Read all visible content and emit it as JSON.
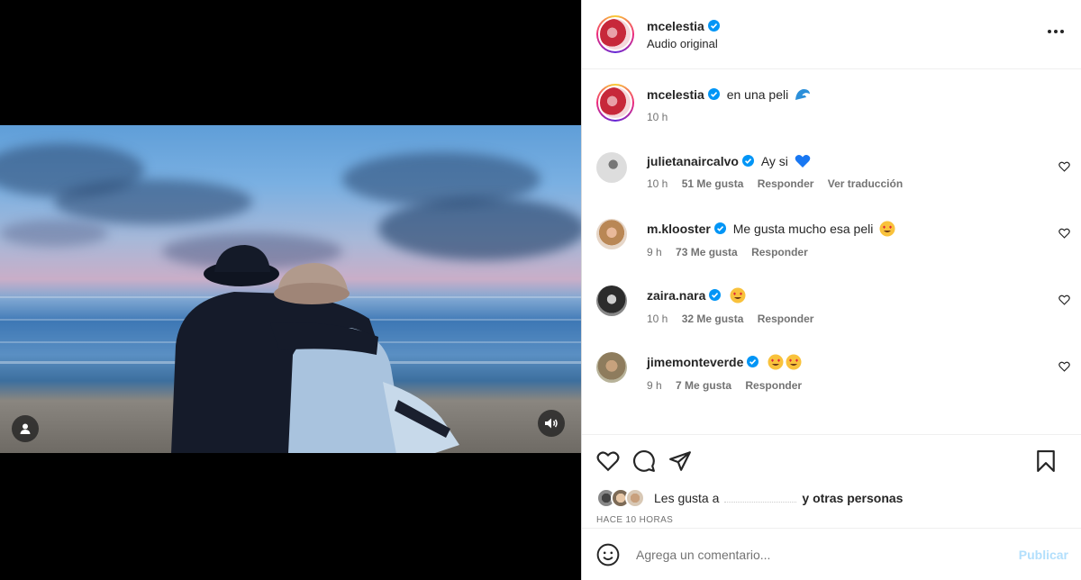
{
  "header": {
    "username": "mcelestia",
    "subtitle": "Audio original",
    "more_icon": "more-horizontal-icon"
  },
  "caption": {
    "username": "mcelestia",
    "text": "en una peli",
    "time": "10 h",
    "emoji": "wave-emoji"
  },
  "comments": [
    {
      "username": "julietanaircalvo",
      "text": "Ay si",
      "emoji": "blue-heart-emoji",
      "time": "10 h",
      "likes": "51 Me gusta",
      "reply": "Responder",
      "translate": "Ver traducción"
    },
    {
      "username": "m.klooster",
      "text": "Me gusta mucho esa peli",
      "emoji": "heart-eyes-emoji",
      "time": "9 h",
      "likes": "73 Me gusta",
      "reply": "Responder"
    },
    {
      "username": "zaira.nara",
      "text": "",
      "emoji": "heart-eyes-emoji",
      "time": "10 h",
      "likes": "32 Me gusta",
      "reply": "Responder"
    },
    {
      "username": "jimemonteverde",
      "text": "",
      "emoji": "heart-eyes-emoji-x2",
      "time": "9 h",
      "likes": "7 Me gusta",
      "reply": "Responder"
    }
  ],
  "likes_line": {
    "prefix": "Les gusta a",
    "suffix": "y otras personas",
    "time": "HACE 10 HORAS"
  },
  "comment_input": {
    "placeholder": "Agrega un comentario...",
    "publish": "Publicar"
  },
  "colors": {
    "verified": "#0095f6",
    "publish": "#b2dffc",
    "blue_heart": "#1877f2",
    "emoji_face": "#f9c23c"
  }
}
